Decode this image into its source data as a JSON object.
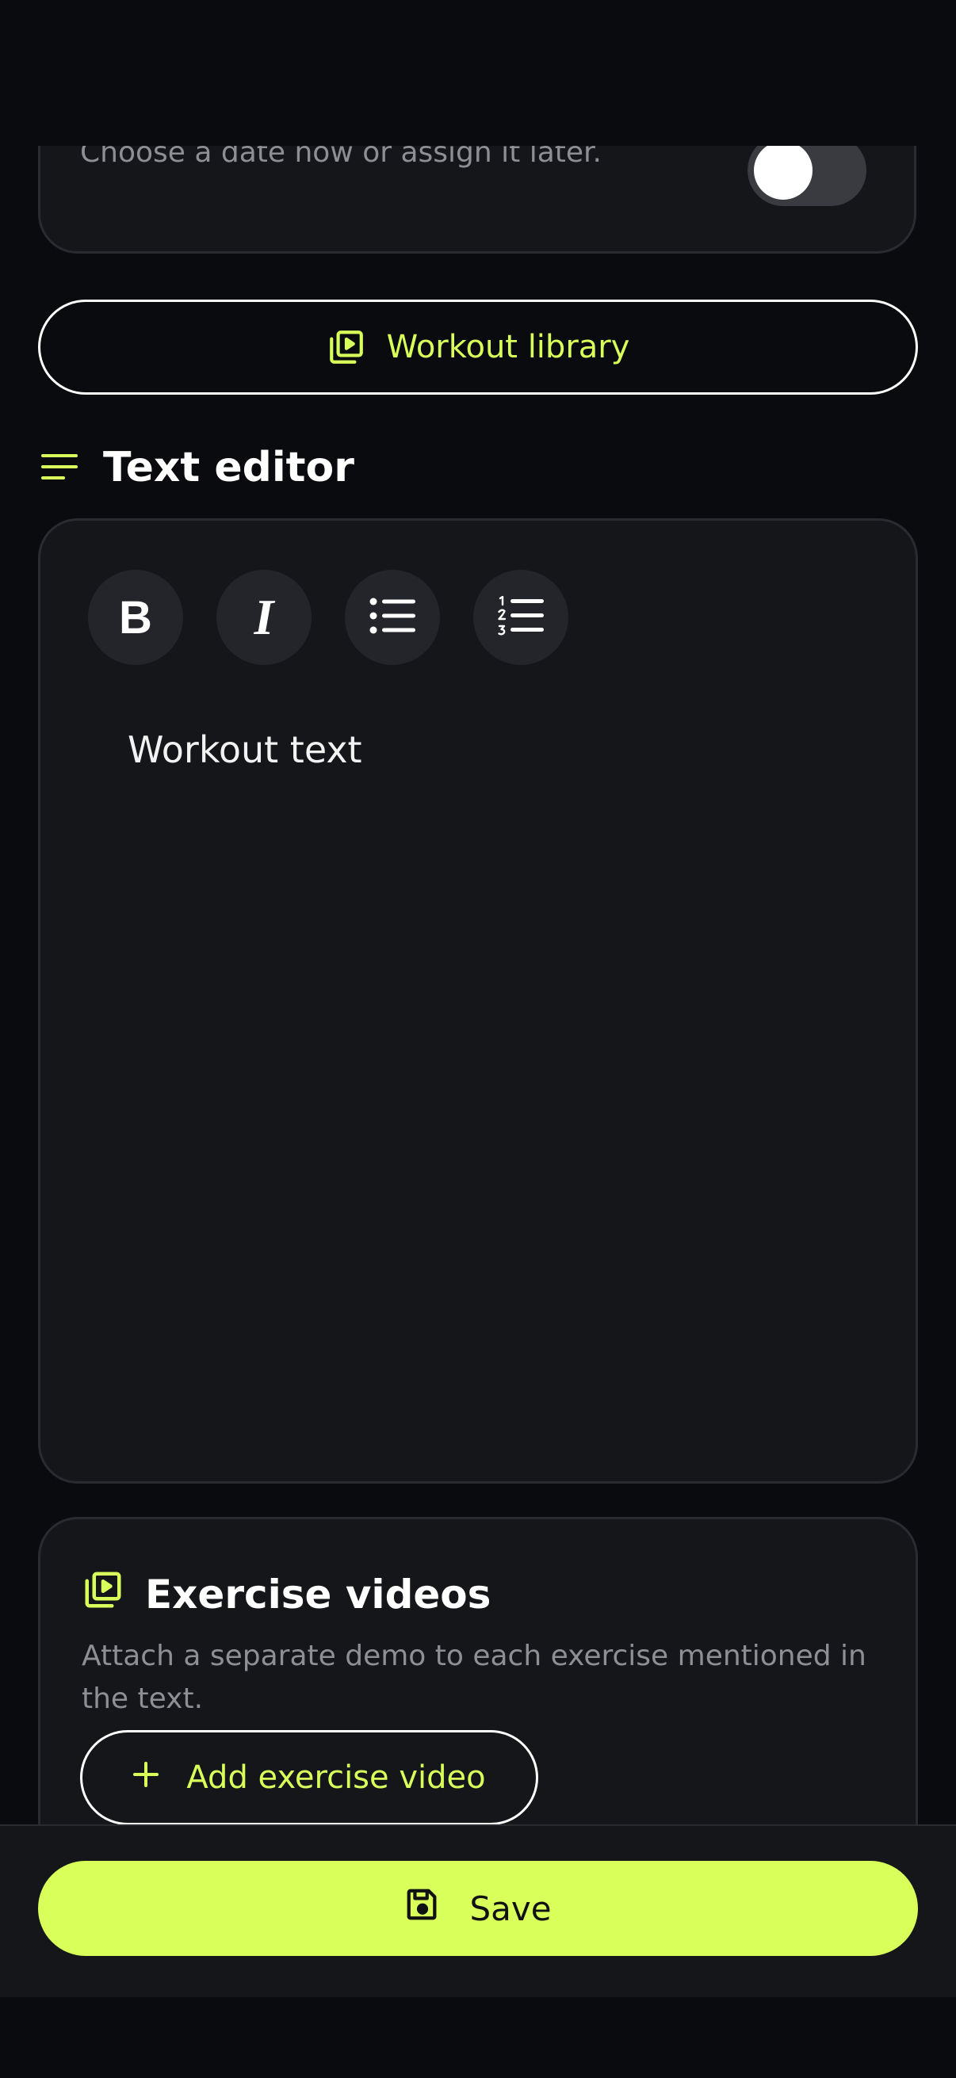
{
  "colors": {
    "accent": "#d8ff5a",
    "background": "#0a0b0e",
    "card": "#15161a",
    "muted_text": "#8e8f95"
  },
  "scheduling": {
    "subtitle": "Choose a date now or assign it later.",
    "toggle_on": true
  },
  "workout_library": {
    "label": "Workout library",
    "icon": "video-library-icon"
  },
  "text_editor": {
    "title": "Text editor",
    "icon": "text-lines-icon",
    "toolbar": [
      {
        "name": "bold",
        "glyph": "B"
      },
      {
        "name": "italic",
        "glyph": "I"
      },
      {
        "name": "bullet-list",
        "icon": "bullet-list-icon"
      },
      {
        "name": "numbered-list",
        "icon": "numbered-list-icon"
      }
    ],
    "placeholder": "Workout text"
  },
  "exercise_videos": {
    "title": "Exercise videos",
    "icon": "video-library-icon",
    "description": "Attach a separate demo to each exercise mentioned in the text.",
    "add_button": "Add exercise video",
    "add_icon": "plus-icon"
  },
  "footer": {
    "save_label": "Save",
    "save_icon": "floppy-disk-icon"
  }
}
